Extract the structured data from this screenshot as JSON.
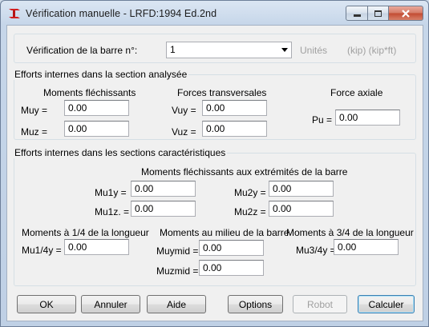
{
  "window": {
    "title": "Vérification manuelle - LRFD:1994 Ed.2nd",
    "icon": "steel-i-beam-icon",
    "controls": [
      "minimize-icon",
      "maximize-icon",
      "close-icon"
    ]
  },
  "top": {
    "bar_label": "Vérification de la barre n°:",
    "bar_value": "1",
    "units_label": "Unités",
    "units_value": "(kip) (kip*ft)"
  },
  "section": {
    "legend": "Efforts internes dans la section analysée",
    "moments_header": "Moments fléchissants",
    "forces_header": "Forces transversales",
    "axial_header": "Force axiale",
    "muy_label": "Muy =",
    "muy": "0.00",
    "muz_label": "Muz =",
    "muz": "0.00",
    "vuy_label": "Vuy =",
    "vuy": "0.00",
    "vuz_label": "Vuz =",
    "vuz": "0.00",
    "pu_label": "Pu =",
    "pu": "0.00"
  },
  "characteristic": {
    "legend": "Efforts internes dans les sections caractéristiques",
    "ends_header": "Moments fléchissants aux extrémités de la barre",
    "mu1y_label": "Mu1y =",
    "mu1y": "0.00",
    "mu1z_label": "Mu1z. =",
    "mu1z": "0.00",
    "mu2y_label": "Mu2y =",
    "mu2y": "0.00",
    "mu2z_label": "Mu2z =",
    "mu2z": "0.00",
    "quarter_header": "Moments à 1/4 de la longueur",
    "mu14y_label": "Mu1/4y =",
    "mu14y": "0.00",
    "mid_header": "Moments au milieu de la barre",
    "muymid_label": "Muymid =",
    "muymid": "0.00",
    "muzmid_label": "Muzmid =",
    "muzmid": "0.00",
    "threeq_header": "Moments à 3/4 de la longueur",
    "mu34y_label": "Mu3/4y =",
    "mu34y": "0.00"
  },
  "buttons": {
    "ok": "OK",
    "cancel": "Annuler",
    "help": "Aide",
    "options": "Options",
    "robot": "Robot",
    "compute": "Calculer"
  }
}
